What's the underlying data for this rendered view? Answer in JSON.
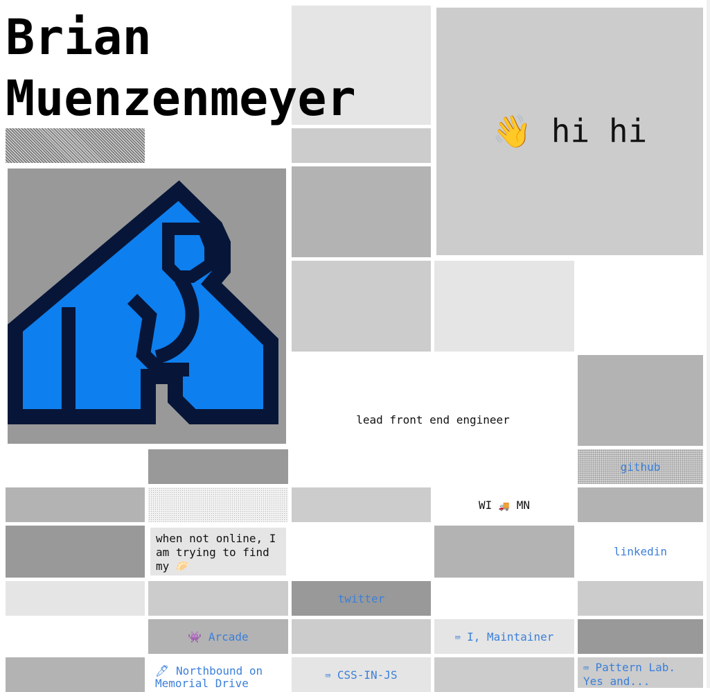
{
  "profile": {
    "name_line1": "Brian",
    "name_line2": "Muenzenmeyer",
    "greeting_emoji": "👋",
    "greeting": "hi hi",
    "role": "lead front end engineer",
    "location_from": "WI",
    "location_vehicle": "🚚",
    "location_to": "MN",
    "hobby_text": "when not online, I am trying to find my",
    "hobby_emoji": "🥟"
  },
  "links": {
    "github": "github",
    "linkedin": "linkedin",
    "twitter": "twitter"
  },
  "projects": {
    "arcade": {
      "icon": "👾",
      "label": "Arcade"
    },
    "maintainer": {
      "icon": "⌨",
      "label": "I, Maintainer"
    },
    "northbound": {
      "icon": "🖊",
      "label": "Northbound on Memorial Drive"
    },
    "cssinjs": {
      "icon": "⌨",
      "label": "CSS-IN-JS"
    },
    "patternlab": {
      "icon": "⌨",
      "label": "Pattern Lab. Yes and..."
    }
  },
  "logo": {
    "icon": "gorilla-logo-icon",
    "fill": "#0e7fef",
    "outline": "#071638",
    "background": "#999999"
  }
}
